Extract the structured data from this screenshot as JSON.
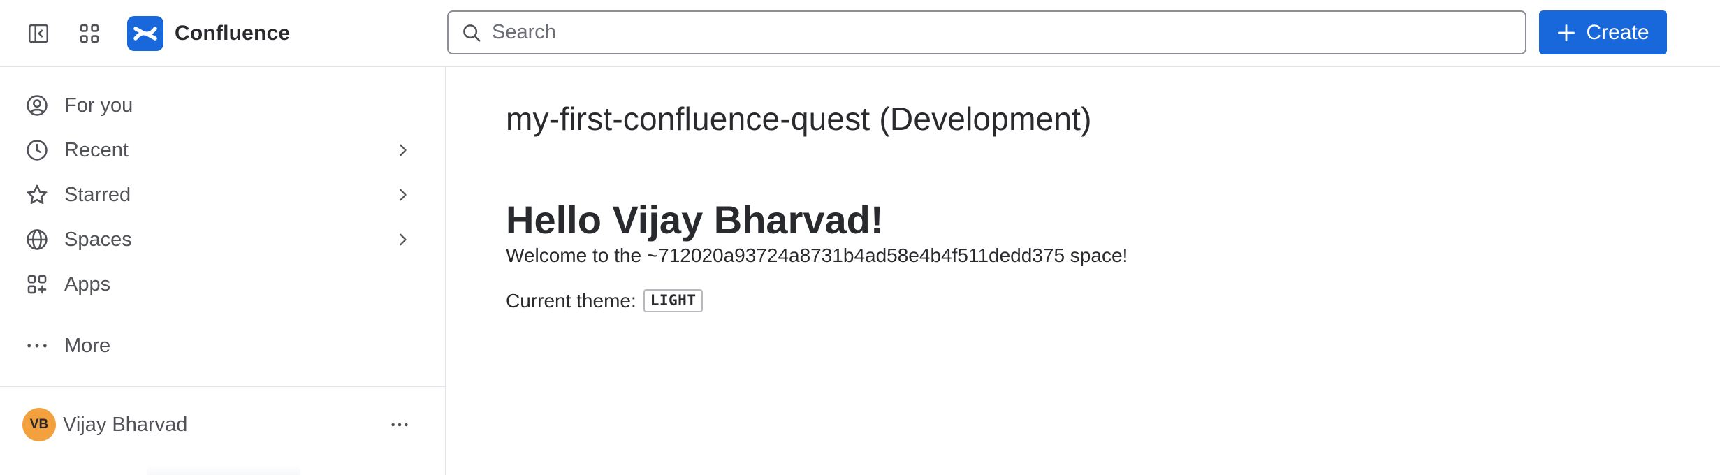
{
  "topbar": {
    "sidebar_toggle_icon": "sidebar-collapse-icon",
    "app_switcher_icon": "app-grid-icon",
    "brand_name": "Confluence",
    "brand_color": "#1868db",
    "search": {
      "placeholder": "Search",
      "value": ""
    },
    "create_label": "Create"
  },
  "sidebar": {
    "items": [
      {
        "label": "For you",
        "icon": "user-circle-icon",
        "has_chevron": false
      },
      {
        "label": "Recent",
        "icon": "clock-icon",
        "has_chevron": true
      },
      {
        "label": "Starred",
        "icon": "star-icon",
        "has_chevron": true
      },
      {
        "label": "Spaces",
        "icon": "globe-icon",
        "has_chevron": true
      },
      {
        "label": "Apps",
        "icon": "apps-add-icon",
        "has_chevron": false
      },
      {
        "label": "More",
        "icon": "more-dots-icon",
        "has_chevron": false
      }
    ],
    "user": {
      "initials": "VB",
      "name": "Vijay Bharvad",
      "avatar_color": "#f3a03e"
    }
  },
  "main": {
    "space_title": "my-first-confluence-quest (Development)",
    "greeting": "Hello Vijay Bharvad!",
    "welcome": "Welcome to the ~712020a93724a8731b4ad58e4b4f511dedd375 space!",
    "theme_label": "Current theme:",
    "theme_value": "LIGHT"
  }
}
